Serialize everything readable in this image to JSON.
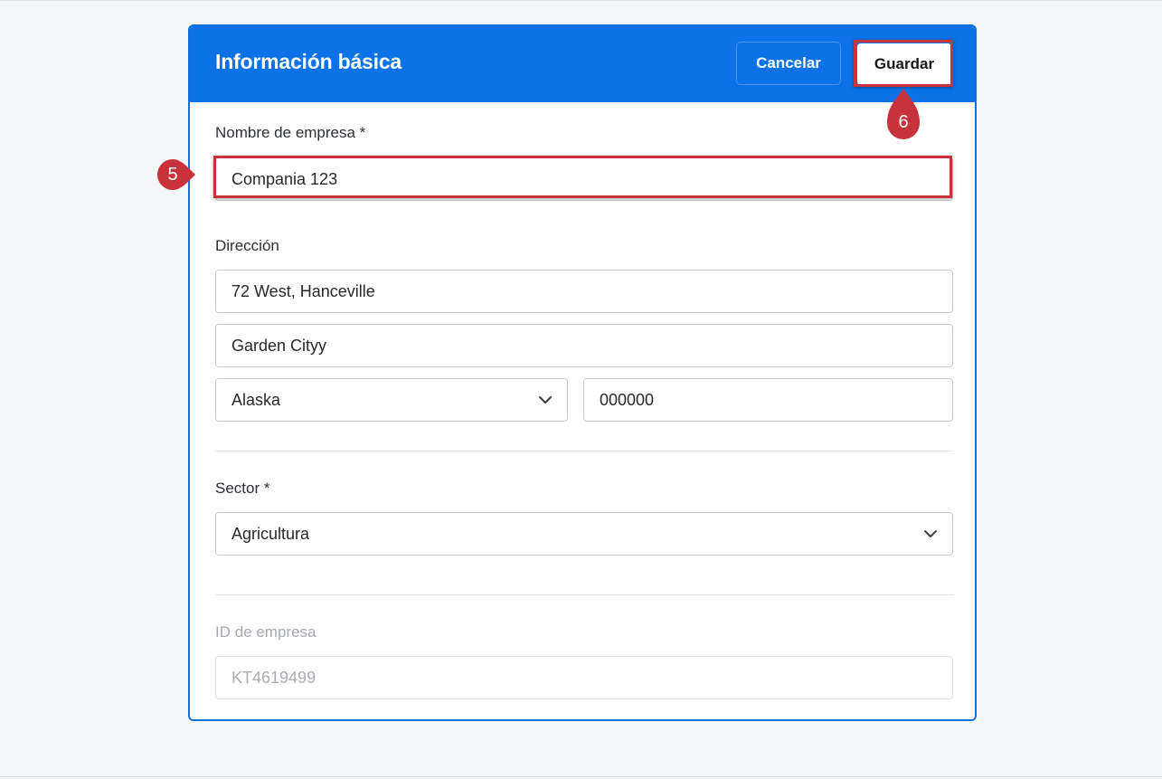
{
  "header": {
    "title": "Información básica",
    "cancel_label": "Cancelar",
    "save_label": "Guardar"
  },
  "form": {
    "company_name": {
      "label": "Nombre de empresa *",
      "value": "Compania 123"
    },
    "address": {
      "label": "Dirección",
      "line1": "72 West, Hanceville",
      "line2": "Garden Cityy",
      "state": "Alaska",
      "zip": "000000"
    },
    "sector": {
      "label": "Sector *",
      "value": "Agricultura"
    },
    "company_id": {
      "label": "ID de empresa",
      "value": "KT4619499"
    }
  },
  "annotations": {
    "step5": "5",
    "step6": "6",
    "color": "#c8323a"
  },
  "colors": {
    "primary": "#0b72e7",
    "background": "#f5f6f7"
  }
}
